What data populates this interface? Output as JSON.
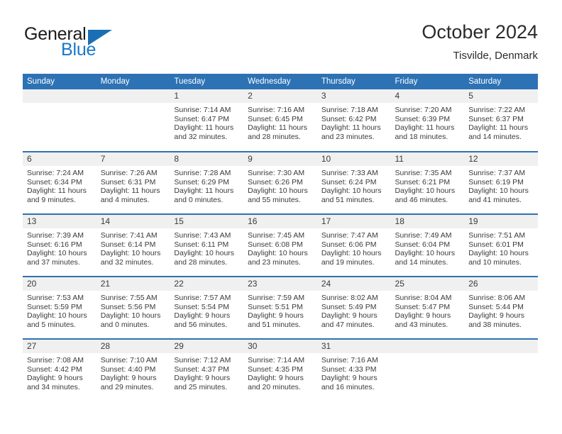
{
  "brand": {
    "name_part1": "General",
    "name_part2": "Blue",
    "logo_icon": "triangle-logo-icon",
    "color_dark": "#1b1b1b",
    "color_blue": "#1878c8"
  },
  "header": {
    "title": "October 2024",
    "subtitle": "Tisvilde, Denmark"
  },
  "theme": {
    "header_bar": "#2d72b4",
    "week_separator": "#2d72b4",
    "daynum_band": "#f0f0f0",
    "text": "#3a3a3a"
  },
  "columns": [
    "Sunday",
    "Monday",
    "Tuesday",
    "Wednesday",
    "Thursday",
    "Friday",
    "Saturday"
  ],
  "weeks": [
    [
      {
        "day": "",
        "blank": true
      },
      {
        "day": "",
        "blank": true
      },
      {
        "day": "1",
        "sunrise": "Sunrise: 7:14 AM",
        "sunset": "Sunset: 6:47 PM",
        "daylight1": "Daylight: 11 hours",
        "daylight2": "and 32 minutes."
      },
      {
        "day": "2",
        "sunrise": "Sunrise: 7:16 AM",
        "sunset": "Sunset: 6:45 PM",
        "daylight1": "Daylight: 11 hours",
        "daylight2": "and 28 minutes."
      },
      {
        "day": "3",
        "sunrise": "Sunrise: 7:18 AM",
        "sunset": "Sunset: 6:42 PM",
        "daylight1": "Daylight: 11 hours",
        "daylight2": "and 23 minutes."
      },
      {
        "day": "4",
        "sunrise": "Sunrise: 7:20 AM",
        "sunset": "Sunset: 6:39 PM",
        "daylight1": "Daylight: 11 hours",
        "daylight2": "and 18 minutes."
      },
      {
        "day": "5",
        "sunrise": "Sunrise: 7:22 AM",
        "sunset": "Sunset: 6:37 PM",
        "daylight1": "Daylight: 11 hours",
        "daylight2": "and 14 minutes."
      }
    ],
    [
      {
        "day": "6",
        "sunrise": "Sunrise: 7:24 AM",
        "sunset": "Sunset: 6:34 PM",
        "daylight1": "Daylight: 11 hours",
        "daylight2": "and 9 minutes."
      },
      {
        "day": "7",
        "sunrise": "Sunrise: 7:26 AM",
        "sunset": "Sunset: 6:31 PM",
        "daylight1": "Daylight: 11 hours",
        "daylight2": "and 4 minutes."
      },
      {
        "day": "8",
        "sunrise": "Sunrise: 7:28 AM",
        "sunset": "Sunset: 6:29 PM",
        "daylight1": "Daylight: 11 hours",
        "daylight2": "and 0 minutes."
      },
      {
        "day": "9",
        "sunrise": "Sunrise: 7:30 AM",
        "sunset": "Sunset: 6:26 PM",
        "daylight1": "Daylight: 10 hours",
        "daylight2": "and 55 minutes."
      },
      {
        "day": "10",
        "sunrise": "Sunrise: 7:33 AM",
        "sunset": "Sunset: 6:24 PM",
        "daylight1": "Daylight: 10 hours",
        "daylight2": "and 51 minutes."
      },
      {
        "day": "11",
        "sunrise": "Sunrise: 7:35 AM",
        "sunset": "Sunset: 6:21 PM",
        "daylight1": "Daylight: 10 hours",
        "daylight2": "and 46 minutes."
      },
      {
        "day": "12",
        "sunrise": "Sunrise: 7:37 AM",
        "sunset": "Sunset: 6:19 PM",
        "daylight1": "Daylight: 10 hours",
        "daylight2": "and 41 minutes."
      }
    ],
    [
      {
        "day": "13",
        "sunrise": "Sunrise: 7:39 AM",
        "sunset": "Sunset: 6:16 PM",
        "daylight1": "Daylight: 10 hours",
        "daylight2": "and 37 minutes."
      },
      {
        "day": "14",
        "sunrise": "Sunrise: 7:41 AM",
        "sunset": "Sunset: 6:14 PM",
        "daylight1": "Daylight: 10 hours",
        "daylight2": "and 32 minutes."
      },
      {
        "day": "15",
        "sunrise": "Sunrise: 7:43 AM",
        "sunset": "Sunset: 6:11 PM",
        "daylight1": "Daylight: 10 hours",
        "daylight2": "and 28 minutes."
      },
      {
        "day": "16",
        "sunrise": "Sunrise: 7:45 AM",
        "sunset": "Sunset: 6:08 PM",
        "daylight1": "Daylight: 10 hours",
        "daylight2": "and 23 minutes."
      },
      {
        "day": "17",
        "sunrise": "Sunrise: 7:47 AM",
        "sunset": "Sunset: 6:06 PM",
        "daylight1": "Daylight: 10 hours",
        "daylight2": "and 19 minutes."
      },
      {
        "day": "18",
        "sunrise": "Sunrise: 7:49 AM",
        "sunset": "Sunset: 6:04 PM",
        "daylight1": "Daylight: 10 hours",
        "daylight2": "and 14 minutes."
      },
      {
        "day": "19",
        "sunrise": "Sunrise: 7:51 AM",
        "sunset": "Sunset: 6:01 PM",
        "daylight1": "Daylight: 10 hours",
        "daylight2": "and 10 minutes."
      }
    ],
    [
      {
        "day": "20",
        "sunrise": "Sunrise: 7:53 AM",
        "sunset": "Sunset: 5:59 PM",
        "daylight1": "Daylight: 10 hours",
        "daylight2": "and 5 minutes."
      },
      {
        "day": "21",
        "sunrise": "Sunrise: 7:55 AM",
        "sunset": "Sunset: 5:56 PM",
        "daylight1": "Daylight: 10 hours",
        "daylight2": "and 0 minutes."
      },
      {
        "day": "22",
        "sunrise": "Sunrise: 7:57 AM",
        "sunset": "Sunset: 5:54 PM",
        "daylight1": "Daylight: 9 hours",
        "daylight2": "and 56 minutes."
      },
      {
        "day": "23",
        "sunrise": "Sunrise: 7:59 AM",
        "sunset": "Sunset: 5:51 PM",
        "daylight1": "Daylight: 9 hours",
        "daylight2": "and 51 minutes."
      },
      {
        "day": "24",
        "sunrise": "Sunrise: 8:02 AM",
        "sunset": "Sunset: 5:49 PM",
        "daylight1": "Daylight: 9 hours",
        "daylight2": "and 47 minutes."
      },
      {
        "day": "25",
        "sunrise": "Sunrise: 8:04 AM",
        "sunset": "Sunset: 5:47 PM",
        "daylight1": "Daylight: 9 hours",
        "daylight2": "and 43 minutes."
      },
      {
        "day": "26",
        "sunrise": "Sunrise: 8:06 AM",
        "sunset": "Sunset: 5:44 PM",
        "daylight1": "Daylight: 9 hours",
        "daylight2": "and 38 minutes."
      }
    ],
    [
      {
        "day": "27",
        "sunrise": "Sunrise: 7:08 AM",
        "sunset": "Sunset: 4:42 PM",
        "daylight1": "Daylight: 9 hours",
        "daylight2": "and 34 minutes."
      },
      {
        "day": "28",
        "sunrise": "Sunrise: 7:10 AM",
        "sunset": "Sunset: 4:40 PM",
        "daylight1": "Daylight: 9 hours",
        "daylight2": "and 29 minutes."
      },
      {
        "day": "29",
        "sunrise": "Sunrise: 7:12 AM",
        "sunset": "Sunset: 4:37 PM",
        "daylight1": "Daylight: 9 hours",
        "daylight2": "and 25 minutes."
      },
      {
        "day": "30",
        "sunrise": "Sunrise: 7:14 AM",
        "sunset": "Sunset: 4:35 PM",
        "daylight1": "Daylight: 9 hours",
        "daylight2": "and 20 minutes."
      },
      {
        "day": "31",
        "sunrise": "Sunrise: 7:16 AM",
        "sunset": "Sunset: 4:33 PM",
        "daylight1": "Daylight: 9 hours",
        "daylight2": "and 16 minutes."
      },
      {
        "day": "",
        "blank": true
      },
      {
        "day": "",
        "blank": true
      }
    ]
  ]
}
